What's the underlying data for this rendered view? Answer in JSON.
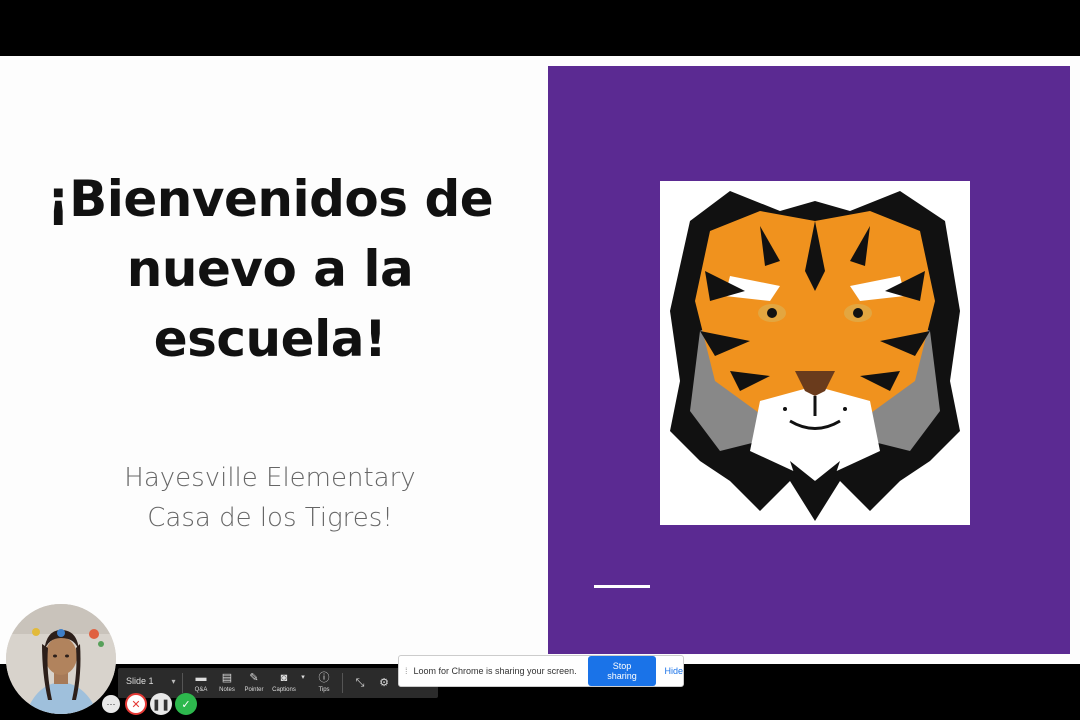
{
  "slide": {
    "title_lines": [
      "¡Bienvenidos de",
      "nuevo a la",
      "escuela!"
    ],
    "subtitle_lines": [
      "Hayesville Elementary",
      "Casa de los Tigres!"
    ]
  },
  "toolbar": {
    "slide_label": "Slide 1",
    "tools": [
      {
        "label": "Q&A",
        "icon": "qa-icon"
      },
      {
        "label": "Notes",
        "icon": "notes-icon"
      },
      {
        "label": "Pointer",
        "icon": "pointer-icon"
      },
      {
        "label": "Captions",
        "icon": "captions-icon"
      },
      {
        "label": "Tips",
        "icon": "info-icon"
      }
    ]
  },
  "share_banner": {
    "message": "Loom for Chrome is sharing your screen.",
    "stop_label": "Stop sharing",
    "hide_label": "Hide"
  },
  "recording_controls": [
    {
      "name": "more-options-button",
      "color": "#e8e8e8"
    },
    {
      "name": "cancel-recording-button",
      "color": "#e53935"
    },
    {
      "name": "pause-recording-button",
      "color": "#e8e8e8"
    },
    {
      "name": "finish-recording-button",
      "color": "#2db84d"
    }
  ],
  "colors": {
    "panel_purple": "#5b2a92",
    "button_blue": "#1a73e8"
  }
}
